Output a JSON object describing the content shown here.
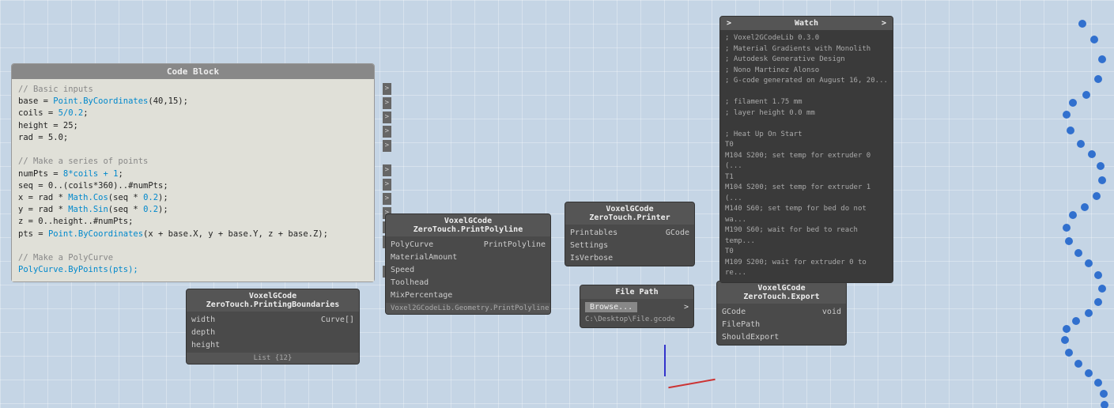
{
  "viewport": {
    "background_color": "#c5d5e5"
  },
  "code_block": {
    "title": "Code Block",
    "lines": [
      {
        "type": "comment",
        "text": "// Basic inputs"
      },
      {
        "type": "code",
        "text": "base = Point.ByCoordinates(40,15);"
      },
      {
        "type": "code",
        "text": "coils = 5/0.2;"
      },
      {
        "type": "code",
        "text": "height = 25;"
      },
      {
        "type": "code",
        "text": "rad = 5.0;"
      },
      {
        "type": "blank",
        "text": ""
      },
      {
        "type": "comment",
        "text": "// Make a series of points"
      },
      {
        "type": "code",
        "text": "numPts = 8*coils + 1;"
      },
      {
        "type": "code",
        "text": "seq = 0..(coils*360)..#numPts;"
      },
      {
        "type": "code",
        "text": "x = rad * Math.Cos(seq * 0.2);"
      },
      {
        "type": "code",
        "text": "y = rad * Math.Sin(seq * 0.2);"
      },
      {
        "type": "code",
        "text": "z = 0..height..#numPts;"
      },
      {
        "type": "code",
        "text": "pts = Point.ByCoordinates(x + base.X, y + base.Y, z + base.Z);"
      },
      {
        "type": "blank",
        "text": ""
      },
      {
        "type": "comment",
        "text": "// Make a PolyCurve"
      },
      {
        "type": "cyan",
        "text": "PolyCurve.ByPoints(pts);"
      }
    ],
    "out_ports": [
      ">",
      ">",
      ">",
      ">",
      ">",
      ">",
      ">",
      ">",
      ">",
      ">",
      ">",
      ">"
    ]
  },
  "printing_boundaries": {
    "title": "VoxelGCode ZeroTouch.PrintingBoundaries",
    "inputs": [
      "width",
      "depth",
      "height"
    ],
    "outputs": [
      "Curve[]"
    ],
    "footer": "List",
    "footer_value": "{12}"
  },
  "print_polyline": {
    "title": "VoxelGCode ZeroTouch.PrintPolyline",
    "inputs": [
      "PolyCurve",
      "MaterialAmount",
      "Speed",
      "Toolhead",
      "MixPercentage"
    ],
    "output": "PrintPolyline",
    "footer": "Voxel2GCodeLib.Geometry.PrintPolyline"
  },
  "printer": {
    "title": "VoxelGCode ZeroTouch.Printer",
    "inputs": [
      "Printables",
      "Settings",
      "IsVerbose"
    ],
    "output": "GCode"
  },
  "file_path": {
    "title": "File Path",
    "browse_label": "Browse...",
    "arrow": ">",
    "value": "C:\\Desktop\\File.gcode"
  },
  "export": {
    "title": "VoxelGCode ZeroTouch.Export",
    "inputs": [
      "GCode",
      "FilePath",
      "ShouldExport"
    ],
    "output": "void"
  },
  "watch": {
    "title": "Watch",
    "in_port": ">",
    "out_port": ">",
    "content": [
      "; Voxel2GCodeLib 0.3.0",
      "; Material Gradients with Monolith",
      "; Autodesk Generative Design",
      "; Nono Martinez Alonso",
      "; G-code generated on August 16, 20...",
      "",
      "; filament 1.75 mm",
      "; layer height 0.0 mm",
      "",
      "; Heat Up On Start",
      "T0",
      "M104 S200; set temp for extruder 0 (...",
      "T1",
      "M104 S200; set temp for extruder 1 (...",
      "M140 S60; set temp for bed do not wa...",
      "M190 S60; wait for bed to reach temp...",
      "T0",
      "M109 S200; wait for extruder 0 to re..."
    ]
  }
}
